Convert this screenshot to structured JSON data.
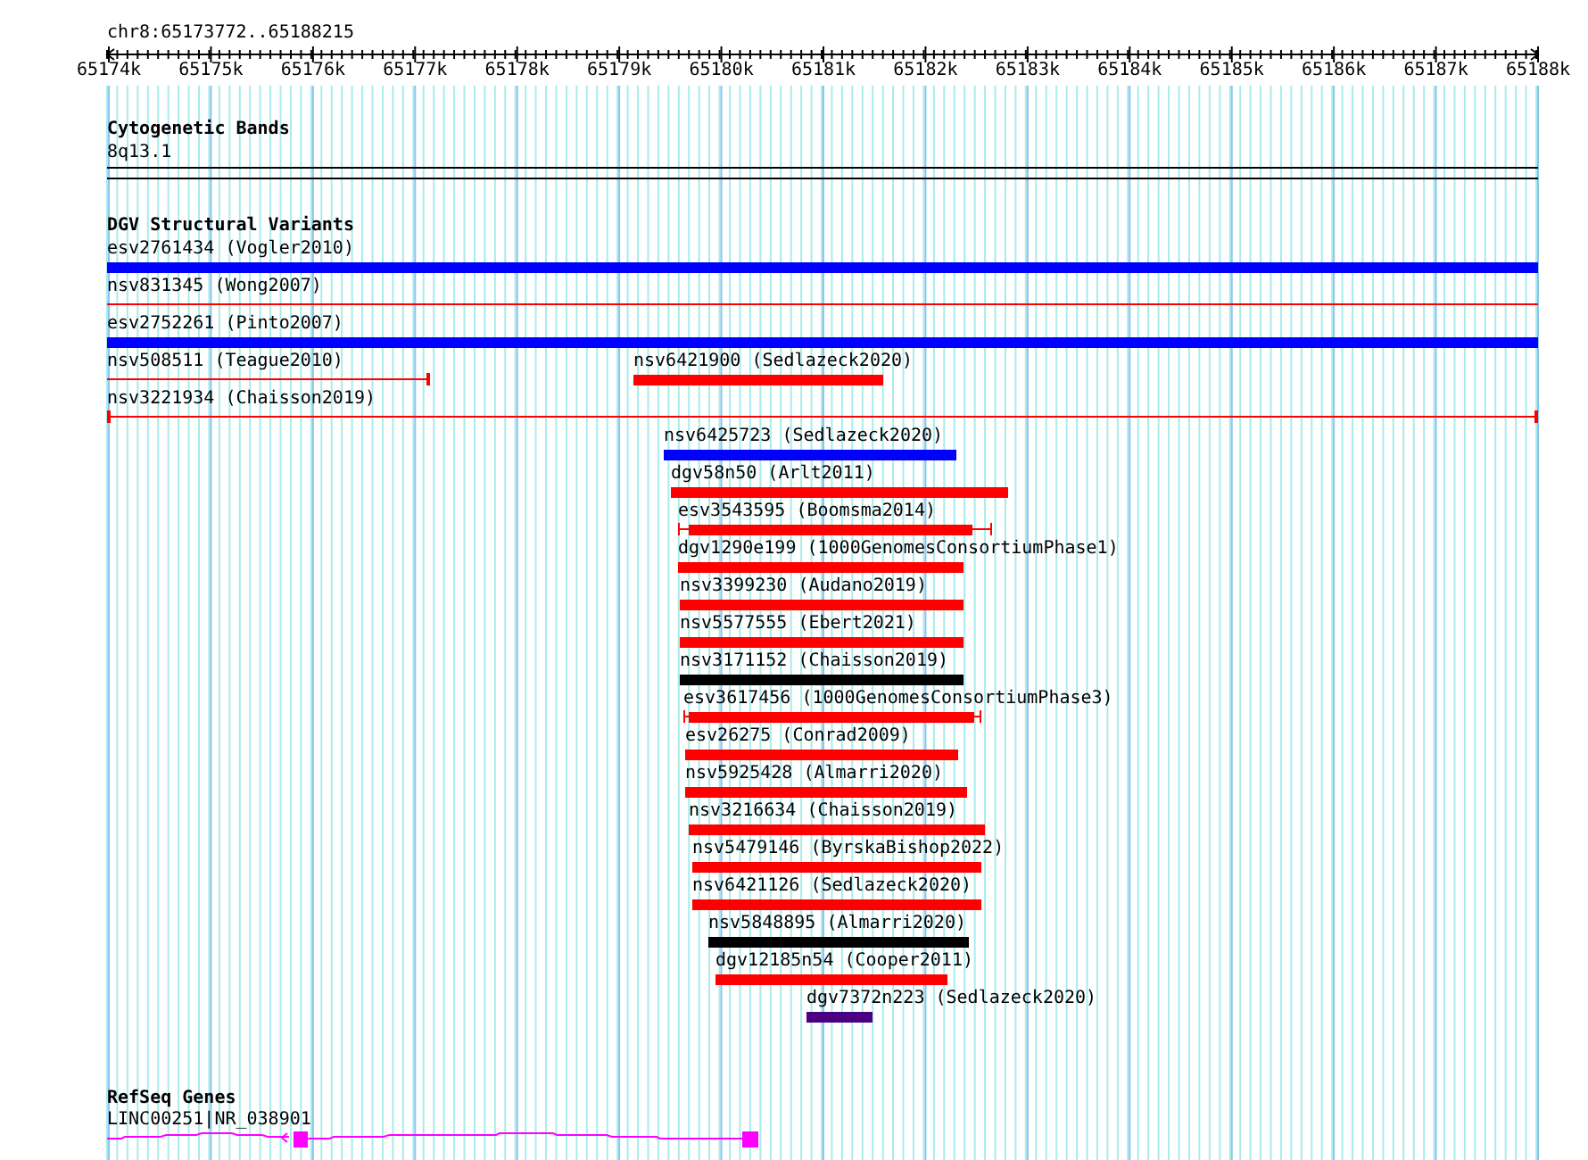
{
  "coordinates": "chr8:65173772..65188215",
  "ruler_ticks": [
    "65174k",
    "65175k",
    "65176k",
    "65177k",
    "65178k",
    "65179k",
    "65180k",
    "65181k",
    "65182k",
    "65183k",
    "65184k",
    "65185k",
    "65186k",
    "65187k",
    "65188k"
  ],
  "cytogenetic_bands": {
    "title": "Cytogenetic Bands",
    "band": "8q13.1"
  },
  "dgv_structural_variants": {
    "title": "DGV Structural Variants",
    "variants": [
      {
        "label": "esv2761434 (Vogler2010)",
        "kind": "thick",
        "color": "#0000ff"
      },
      {
        "label": "nsv831345 (Wong2007)",
        "kind": "thin",
        "color": "#ff0000"
      },
      {
        "label": "esv2752261 (Pinto2007)",
        "kind": "thick",
        "color": "#0000ff"
      },
      {
        "label": "nsv508511 (Teague2010)",
        "kind": "thin",
        "color": "#ff0000"
      },
      {
        "label": "nsv6421900 (Sedlazeck2020)",
        "kind": "thick",
        "color": "#ff0000"
      },
      {
        "label": "nsv3221934 (Chaisson2019)",
        "kind": "thin",
        "color": "#ff0000"
      },
      {
        "label": "nsv6425723 (Sedlazeck2020)",
        "kind": "thick",
        "color": "#0000ff"
      },
      {
        "label": "dgv58n50 (Arlt2011)",
        "kind": "thick",
        "color": "#ff0000"
      },
      {
        "label": "esv3543595 (Boomsma2014)",
        "kind": "whisker",
        "color": "#ff0000"
      },
      {
        "label": "dgv1290e199 (1000GenomesConsortiumPhase1)",
        "kind": "thick",
        "color": "#ff0000"
      },
      {
        "label": "nsv3399230 (Audano2019)",
        "kind": "thick",
        "color": "#ff0000"
      },
      {
        "label": "nsv5577555 (Ebert2021)",
        "kind": "thick",
        "color": "#ff0000"
      },
      {
        "label": "nsv3171152 (Chaisson2019)",
        "kind": "thick",
        "color": "#000000"
      },
      {
        "label": "esv3617456 (1000GenomesConsortiumPhase3)",
        "kind": "whisker",
        "color": "#ff0000"
      },
      {
        "label": "esv26275 (Conrad2009)",
        "kind": "thick",
        "color": "#ff0000"
      },
      {
        "label": "nsv5925428 (Almarri2020)",
        "kind": "thick",
        "color": "#ff0000"
      },
      {
        "label": "nsv3216634 (Chaisson2019)",
        "kind": "thick",
        "color": "#ff0000"
      },
      {
        "label": "nsv5479146 (ByrskaBishop2022)",
        "kind": "thick",
        "color": "#ff0000"
      },
      {
        "label": "nsv6421126 (Sedlazeck2020)",
        "kind": "thick",
        "color": "#ff0000"
      },
      {
        "label": "nsv5848895 (Almarri2020)",
        "kind": "thick",
        "color": "#000000"
      },
      {
        "label": "dgv12185n54 (Cooper2011)",
        "kind": "thick",
        "color": "#ff0000"
      },
      {
        "label": "dgv7372n223 (Sedlazeck2020)",
        "kind": "thick",
        "color": "#4b0082"
      }
    ]
  },
  "refseq_genes": {
    "title": "RefSeq Genes",
    "genes": [
      {
        "label": "LINC00251|NR_038901"
      }
    ]
  }
}
